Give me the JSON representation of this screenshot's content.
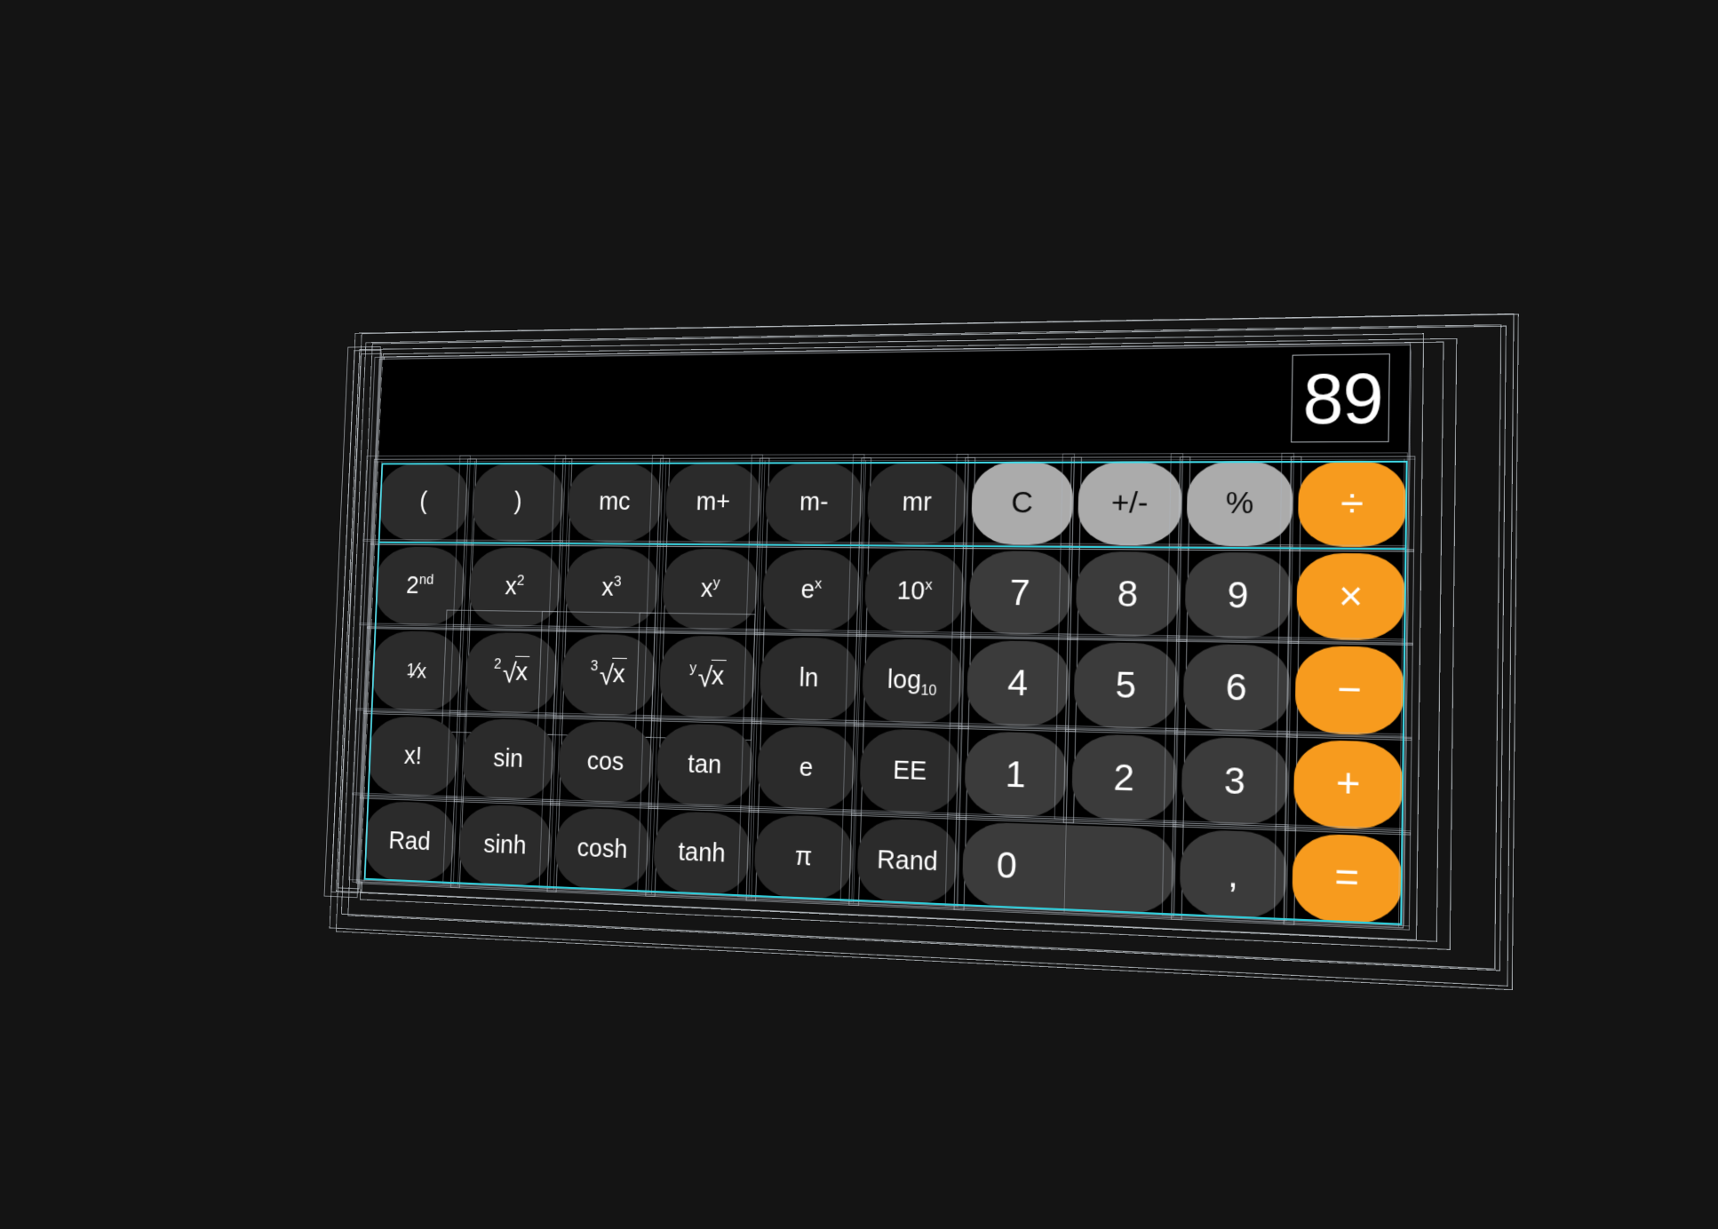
{
  "app": {
    "name": "Calculator",
    "mode": "Scientific",
    "view": "3D wireframe debug / exploded view"
  },
  "display": {
    "value": "89"
  },
  "colors": {
    "background": "#141414",
    "body": "#000000",
    "function_key": "#2b2b2b",
    "number_key": "#3b3b3b",
    "utility_key": "#ababab",
    "accent_key": "#f79b1e",
    "text_light": "#ffffff",
    "text_dark": "#0a0a0a",
    "wireframe": "#c4cad0",
    "highlight": "#3fd8e6"
  },
  "keypad": {
    "rows": [
      [
        {
          "label": "(",
          "kind": "fn"
        },
        {
          "label": ")",
          "kind": "fn"
        },
        {
          "label": "mc",
          "kind": "fn"
        },
        {
          "label": "m+",
          "kind": "fn"
        },
        {
          "label": "m-",
          "kind": "fn"
        },
        {
          "label": "mr",
          "kind": "fn"
        },
        {
          "label": "C",
          "kind": "util"
        },
        {
          "label": "+/-",
          "kind": "util"
        },
        {
          "label": "%",
          "kind": "util"
        },
        {
          "label": "÷",
          "kind": "accent"
        }
      ],
      [
        {
          "label": "2nd",
          "kind": "fn",
          "sup": "nd",
          "base": "2"
        },
        {
          "label": "x2",
          "kind": "fn",
          "sup": "2",
          "base": "x"
        },
        {
          "label": "x3",
          "kind": "fn",
          "sup": "3",
          "base": "x"
        },
        {
          "label": "xy",
          "kind": "fn",
          "sup": "y",
          "base": "x"
        },
        {
          "label": "ex",
          "kind": "fn",
          "sup": "x",
          "base": "e"
        },
        {
          "label": "10x",
          "kind": "fn",
          "sup": "x",
          "base": "10"
        },
        {
          "label": "7",
          "kind": "num"
        },
        {
          "label": "8",
          "kind": "num"
        },
        {
          "label": "9",
          "kind": "num"
        },
        {
          "label": "×",
          "kind": "accent"
        }
      ],
      [
        {
          "label": "1/x",
          "kind": "fn"
        },
        {
          "label": "2√x",
          "kind": "fn",
          "index": "2"
        },
        {
          "label": "3√x",
          "kind": "fn",
          "index": "3"
        },
        {
          "label": "y√x",
          "kind": "fn",
          "index": "y"
        },
        {
          "label": "ln",
          "kind": "fn"
        },
        {
          "label": "log10",
          "kind": "fn",
          "base": "log",
          "sub": "10"
        },
        {
          "label": "4",
          "kind": "num"
        },
        {
          "label": "5",
          "kind": "num"
        },
        {
          "label": "6",
          "kind": "num"
        },
        {
          "label": "−",
          "kind": "accent"
        }
      ],
      [
        {
          "label": "x!",
          "kind": "fn"
        },
        {
          "label": "sin",
          "kind": "fn"
        },
        {
          "label": "cos",
          "kind": "fn"
        },
        {
          "label": "tan",
          "kind": "fn"
        },
        {
          "label": "e",
          "kind": "fn"
        },
        {
          "label": "EE",
          "kind": "fn"
        },
        {
          "label": "1",
          "kind": "num"
        },
        {
          "label": "2",
          "kind": "num"
        },
        {
          "label": "3",
          "kind": "num"
        },
        {
          "label": "+",
          "kind": "accent"
        }
      ],
      [
        {
          "label": "Rad",
          "kind": "fn"
        },
        {
          "label": "sinh",
          "kind": "fn"
        },
        {
          "label": "cosh",
          "kind": "fn"
        },
        {
          "label": "tanh",
          "kind": "fn"
        },
        {
          "label": "π",
          "kind": "fn"
        },
        {
          "label": "Rand",
          "kind": "fn"
        },
        {
          "label": "0",
          "kind": "num",
          "wide": true
        },
        {
          "label": ",",
          "kind": "num"
        },
        {
          "label": "=",
          "kind": "accent"
        }
      ]
    ]
  }
}
